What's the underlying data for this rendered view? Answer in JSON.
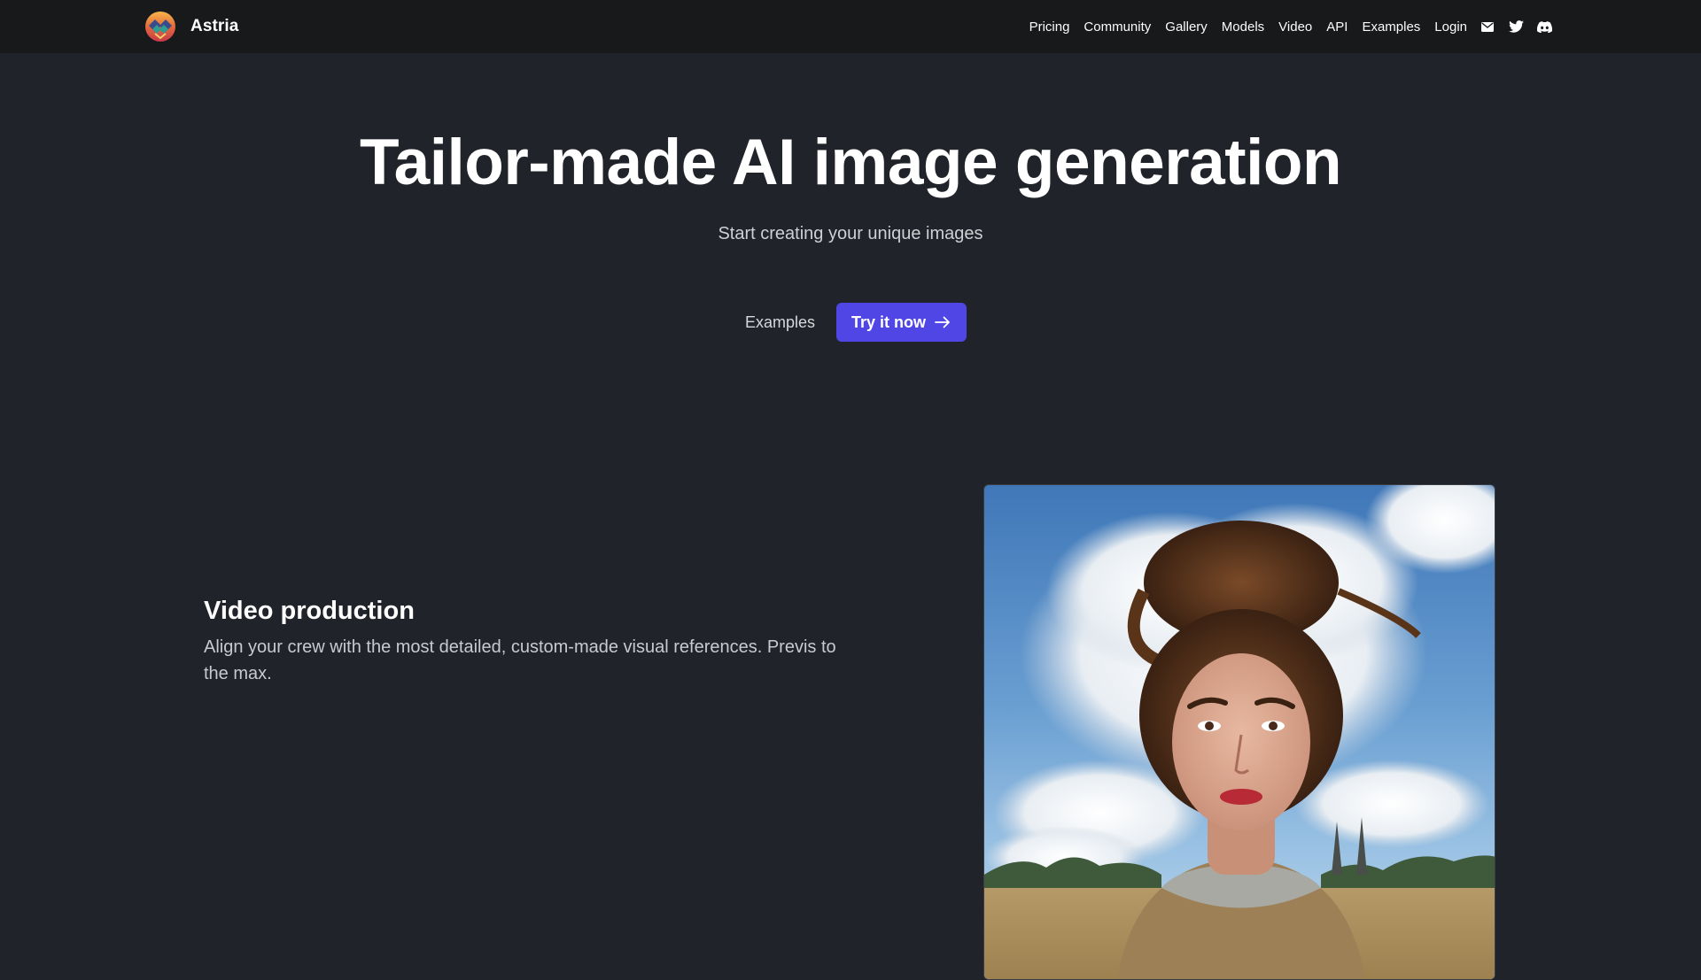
{
  "brand": {
    "name": "Astria",
    "logo_icon": "astria-logo-icon"
  },
  "nav": {
    "links": [
      "Pricing",
      "Community",
      "Gallery",
      "Models",
      "Video",
      "API",
      "Examples",
      "Login"
    ],
    "icons": [
      "mail-icon",
      "twitter-icon",
      "discord-icon"
    ]
  },
  "hero": {
    "title": "Tailor-made AI image generation",
    "subtitle": "Start creating your unique images",
    "secondary_cta": "Examples",
    "primary_cta": "Try it now",
    "primary_color": "#5046e5"
  },
  "feature": {
    "title": "Video production",
    "description": "Align your crew with the most detailed, custom-made visual references. Previs to the max.",
    "image": "portrait-woman-clouds-hair-image"
  },
  "colors": {
    "background": "#202329",
    "nav_background": "#18191b"
  }
}
